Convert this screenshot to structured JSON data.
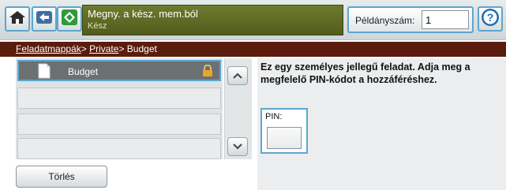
{
  "status": {
    "line1": "Megny. a kész. mem.ból",
    "line2": "Kész"
  },
  "copies": {
    "label": "Példányszám:",
    "value": "1"
  },
  "breadcrumb": {
    "part1": "Feladatmappák",
    "sep1": ">",
    "part2": "Private",
    "sep2": ">",
    "part3": "Budget"
  },
  "list": {
    "items": [
      {
        "name": "Budget",
        "selected": true
      },
      {
        "name": ""
      },
      {
        "name": ""
      },
      {
        "name": ""
      }
    ]
  },
  "info": {
    "message": "Ez egy személyes jellegű feladat. Adja meg a megfelelő PIN-kódot a hozzáféréshez.",
    "pin_label": "PIN:"
  },
  "actions": {
    "delete_label": "Törlés"
  },
  "icons": {
    "home": "home-icon",
    "back": "back-arrow-icon",
    "start": "start-icon",
    "help": "help-icon",
    "document": "document-icon",
    "lock": "lock-icon",
    "scroll_up": "chevron-up-icon",
    "scroll_down": "chevron-down-icon"
  },
  "colors": {
    "accent": "#5da6cf",
    "status_bg": "#5e6a24",
    "breadcrumb_bg": "#5a1c0c",
    "start_green": "#2f9a3b",
    "help_blue": "#1d6fb3"
  }
}
